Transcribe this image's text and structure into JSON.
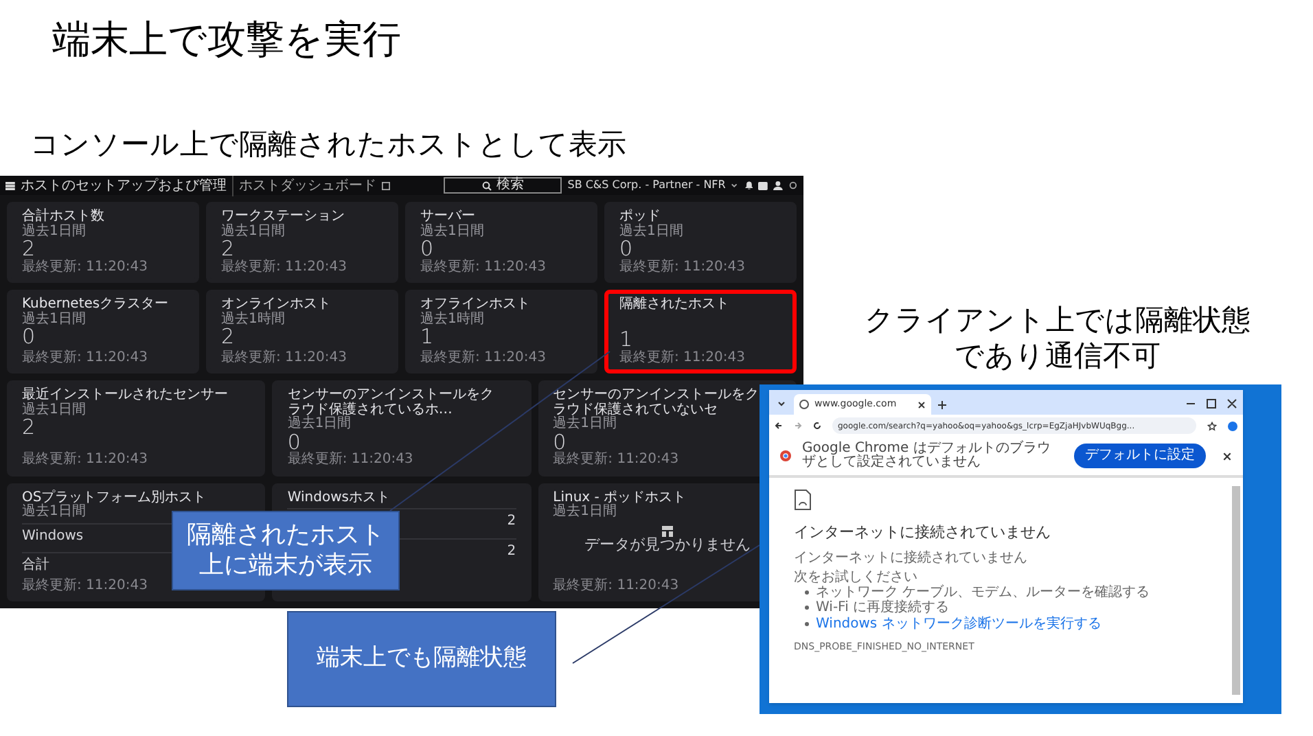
{
  "slide": {
    "title": "端末上で攻撃を実行",
    "subtitle": "コンソール上で隔離されたホストとして表示",
    "client_note": [
      "クライアント上では隔離状態",
      "であり通信不可"
    ],
    "callouts": [
      {
        "text": [
          "隔離されたホスト",
          "上に端末が表示"
        ]
      },
      {
        "text": [
          "端末上でも隔離状態"
        ]
      }
    ]
  },
  "console": {
    "header": {
      "menu_title": "ホストのセットアップおよび管理",
      "page": "ホストダッシュボード",
      "search": "検索",
      "account": "SB C&S Corp. - Partner - NFR"
    },
    "cards": [
      {
        "kind": "stat",
        "title": "合計ホスト数",
        "period": "過去1日間",
        "value": "2",
        "updated": "最終更新: 11:20:43",
        "highlighted": false
      },
      {
        "kind": "stat",
        "title": "ワークステーション",
        "period": "過去1日間",
        "value": "2",
        "updated": "最終更新: 11:20:43",
        "highlighted": false
      },
      {
        "kind": "stat",
        "title": "サーバー",
        "period": "過去1日間",
        "value": "0",
        "updated": "最終更新: 11:20:43",
        "highlighted": false
      },
      {
        "kind": "stat",
        "title": "ポッド",
        "period": "過去1日間",
        "value": "0",
        "updated": "最終更新: 11:20:43",
        "highlighted": false
      },
      {
        "kind": "stat",
        "title": "Kubernetesクラスター",
        "period": "過去1日間",
        "value": "0",
        "updated": "最終更新: 11:20:43",
        "highlighted": false
      },
      {
        "kind": "stat",
        "title": "オンラインホスト",
        "period": "過去1時間",
        "value": "2",
        "updated": "最終更新: 11:20:43",
        "highlighted": false
      },
      {
        "kind": "stat",
        "title": "オフラインホスト",
        "period": "過去1時間",
        "value": "1",
        "updated": "最終更新: 11:20:43",
        "highlighted": false
      },
      {
        "kind": "stat",
        "title": "隔離されたホスト",
        "value": "1",
        "updated": "最終更新: 11:20:43",
        "highlighted": true
      },
      {
        "kind": "stat",
        "title": "最近インストールされたセンサー",
        "period": "過去1日間",
        "value": "2",
        "updated": "最終更新: 11:20:43",
        "highlighted": false
      },
      {
        "kind": "stat",
        "title": "センサーのアンインストールをクラウド保護されているホ…",
        "period": "過去1日間",
        "value": "0",
        "updated": "最終更新: 11:20:43",
        "highlighted": false
      },
      {
        "kind": "stat",
        "title": "センサーのアンインストールをクラウド保護されていないセ",
        "period": "過去1日間",
        "value": "0",
        "updated": "最終更新: 11:20:43",
        "highlighted": false
      },
      {
        "kind": "list",
        "title": "OSプラットフォーム別ホスト",
        "period": "過去1日間",
        "rows": [
          {
            "label": "Windows"
          },
          {
            "label": "合計"
          }
        ],
        "updated": "最終更新: 11:20:43"
      },
      {
        "kind": "list",
        "title": "Windowsホスト",
        "rows": [
          {
            "value": "2"
          },
          {
            "value": "2"
          }
        ]
      },
      {
        "kind": "empty",
        "title": "Linux - ポッドホスト",
        "period": "過去1日間",
        "message": "データが見つかりません",
        "updated": "最終更新: 11:20:43"
      }
    ]
  },
  "browser": {
    "tab": "www.google.com",
    "url": "google.com/search?q=yahoo&oq=yahoo&gs_lcrp=EgZjaHJvbWUqBgg...",
    "banner": "Google Chrome はデフォルトのブラウザとして設定されていません",
    "banner_button": "デフォルトに設定",
    "error": {
      "heading": "インターネットに接続されていません",
      "detail": "インターネットに接続されていません",
      "try_label": "次をお試しください",
      "suggestions": [
        {
          "text": "ネットワーク ケーブル、モデム、ルーターを確認する",
          "link": false
        },
        {
          "text": "Wi-Fi に再度接続する",
          "link": false
        },
        {
          "text": "Windows ネットワーク診断ツールを実行する",
          "link": true
        }
      ],
      "code": "DNS_PROBE_FINISHED_NO_INTERNET"
    }
  }
}
